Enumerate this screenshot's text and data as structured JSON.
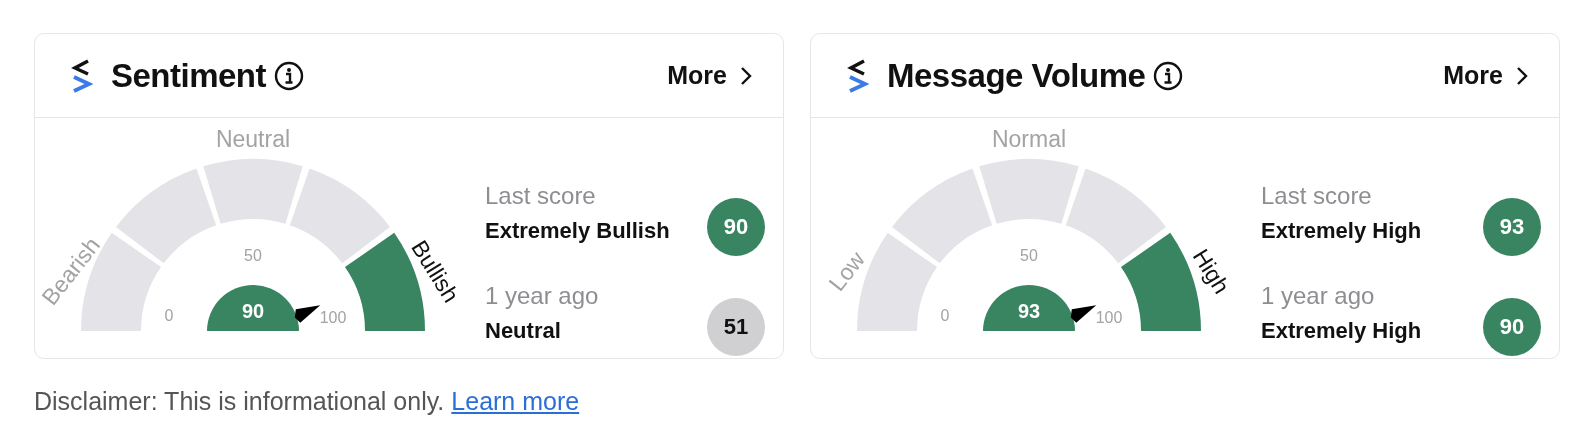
{
  "cards": [
    {
      "title": "Sentiment",
      "more": "More",
      "gauge": {
        "labels": [
          "Bearish",
          "Neutral",
          "Bullish"
        ],
        "ticks": [
          "0",
          "50",
          "100"
        ],
        "value": "90",
        "segments": [
          {
            "selected": false
          },
          {
            "selected": false
          },
          {
            "selected": false
          },
          {
            "selected": false
          },
          {
            "selected": true
          }
        ]
      },
      "scores": [
        {
          "label": "Last score",
          "value_text": "Extremely Bullish",
          "score": "90",
          "color": "#3a8561"
        },
        {
          "label": "1 year ago",
          "value_text": "Neutral",
          "score": "51",
          "color": "#d0d0d3"
        }
      ]
    },
    {
      "title": "Message Volume",
      "more": "More",
      "gauge": {
        "labels": [
          "Low",
          "Normal",
          "High"
        ],
        "ticks": [
          "0",
          "50",
          "100"
        ],
        "value": "93",
        "segments": [
          {
            "selected": false
          },
          {
            "selected": false
          },
          {
            "selected": false
          },
          {
            "selected": false
          },
          {
            "selected": true
          }
        ]
      },
      "scores": [
        {
          "label": "Last score",
          "value_text": "Extremely High",
          "score": "93",
          "color": "#3a8561"
        },
        {
          "label": "1 year ago",
          "value_text": "Extremely High",
          "score": "90",
          "color": "#3a8561"
        }
      ]
    }
  ],
  "disclaimer": {
    "text": "Disclaimer: This is informational only.",
    "link": "Learn more"
  }
}
